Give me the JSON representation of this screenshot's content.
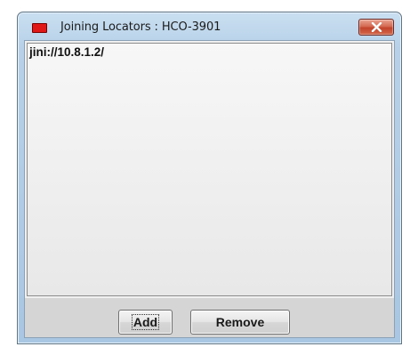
{
  "window": {
    "title": "Joining Locators : HCO-3901",
    "icon": "red-rectangle-icon",
    "close_icon": "close-x-icon"
  },
  "list": {
    "items": [
      "jini://10.8.1.2/"
    ]
  },
  "buttons": {
    "add_label": "Add",
    "remove_label": "Remove"
  },
  "colors": {
    "titlebar": "#b8d1e8",
    "close_button": "#c9503a",
    "app_icon": "#e01818"
  }
}
